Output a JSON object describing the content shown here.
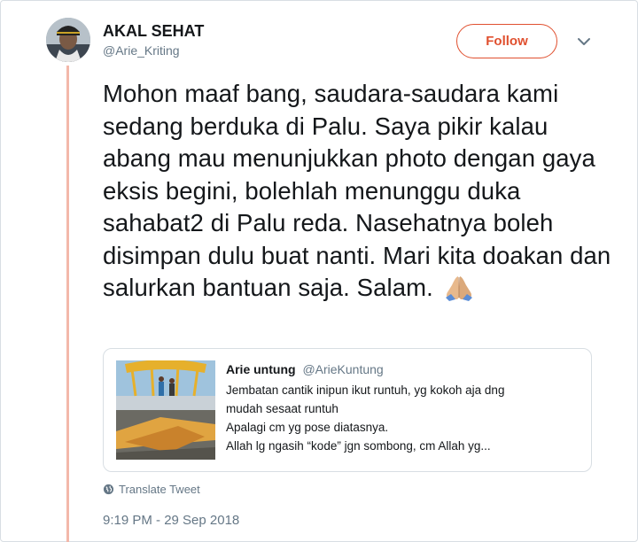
{
  "author": {
    "display_name": "AKAL SEHAT",
    "handle": "@Arie_Kriting"
  },
  "follow_label": "Follow",
  "tweet": {
    "text": "Mohon maaf bang, saudara-saudara kami sedang berduka di Palu. Saya pikir kalau abang mau menunjukkan photo dengan gaya eksis begini, bolehlah menunggu duka sahabat2 di Palu reda. Nasehatnya boleh disimpan dulu buat nanti. Mari kita doakan dan salurkan bantuan saja. Salam.",
    "emoji_icon": "folded-hands-icon"
  },
  "quote": {
    "name": "Arie untung",
    "handle": "@ArieKuntung",
    "lines": [
      "Jembatan cantik inipun ikut runtuh, yg kokoh aja dng",
      "mudah sesaat runtuh",
      "Apalagi cm yg pose diatasnya.",
      "Allah lg ngasih “kode” jgn sombong, cm Allah yg..."
    ]
  },
  "translate_label": "Translate Tweet",
  "timestamp": "9:19 PM - 29 Sep 2018",
  "colors": {
    "accent": "#e0502f",
    "thread_line": "#f3b8aa",
    "secondary_text": "#657786"
  }
}
